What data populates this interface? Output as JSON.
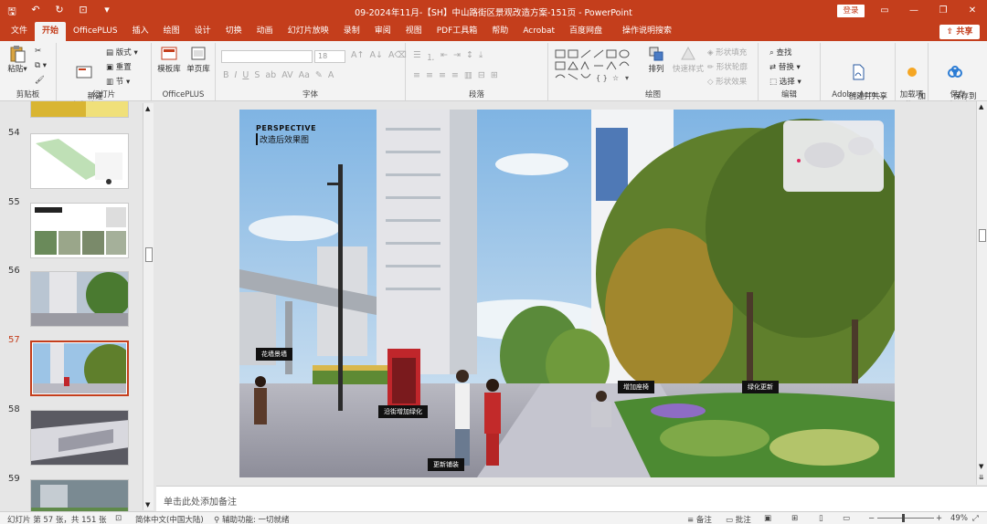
{
  "window": {
    "title": "09-2024年11月-【SH】中山路街区景观改造方案-151页 - PowerPoint",
    "login_label": "登录",
    "share_label": "共享"
  },
  "tabs": [
    "文件",
    "开始",
    "OfficePLUS",
    "插入",
    "绘图",
    "设计",
    "切换",
    "动画",
    "幻灯片放映",
    "录制",
    "审阅",
    "视图",
    "PDF工具箱",
    "帮助",
    "Acrobat",
    "百度网盘",
    "操作说明搜索"
  ],
  "active_tab": "开始",
  "ribbon": {
    "clipboard": {
      "paste": "粘贴",
      "label": "剪贴板"
    },
    "slides": {
      "new_slide": "新建\n幻灯片",
      "layout": "版式",
      "reset": "重置",
      "section": "节",
      "label": "幻灯片"
    },
    "officeplus": {
      "template": "模板库",
      "single": "单页库",
      "label": "OfficePLUS"
    },
    "font": {
      "size": "18",
      "label": "字体"
    },
    "paragraph": {
      "label": "段落"
    },
    "drawing": {
      "arrange": "排列",
      "quick_styles": "快速样式",
      "fill": "形状填充",
      "outline": "形状轮廓",
      "effects": "形状效果",
      "label": "绘图"
    },
    "editing": {
      "find": "查找",
      "replace": "替换",
      "select": "选择",
      "label": "编辑"
    },
    "adobe": {
      "create": "创建并共享\nAdobe PDF",
      "label": "Adobe Acro..."
    },
    "addins": {
      "add": "加\n载项",
      "label": "加载项"
    },
    "save": {
      "save_baidu": "保存到\n百度网盘",
      "label": "保存"
    }
  },
  "slides": [
    {
      "num": "54",
      "active": false
    },
    {
      "num": "55",
      "active": false
    },
    {
      "num": "56",
      "active": false
    },
    {
      "num": "57",
      "active": true
    },
    {
      "num": "58",
      "active": false
    },
    {
      "num": "59",
      "active": false
    }
  ],
  "slide_content": {
    "title_en": "PERSPECTIVE",
    "title_cn": "改造后效果图",
    "tags": {
      "flower_wall": "花墙景墙",
      "roadside_green": "沿街增加绿化",
      "seating": "增加座椅",
      "greenery_update": "绿化更新",
      "paving": "更新铺装"
    }
  },
  "notes_placeholder": "单击此处添加备注",
  "status": {
    "slide_info": "幻灯片 第 57 张，共 151 张",
    "language": "简体中文(中国大陆)",
    "accessibility": "辅助功能: 一切就绪",
    "notes": "备注",
    "comments": "批注",
    "zoom": "49%"
  },
  "colors": {
    "accent": "#c43e1c"
  }
}
